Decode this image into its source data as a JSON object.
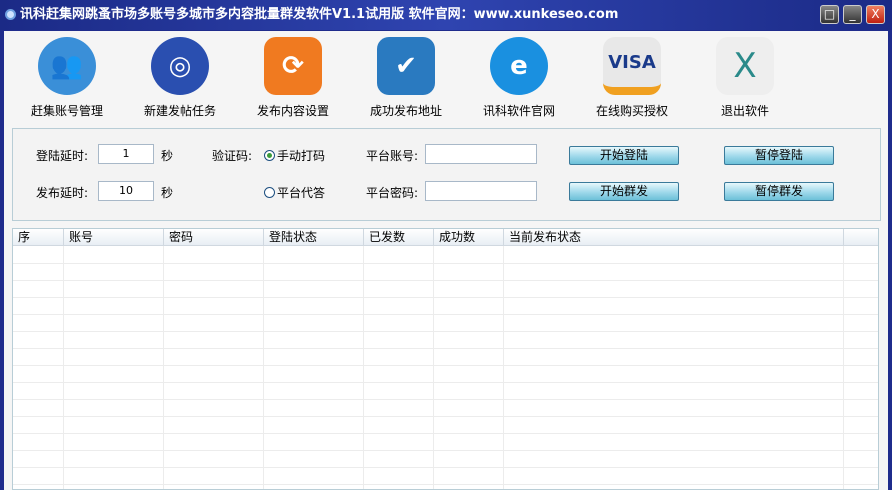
{
  "window": {
    "title": "讯科赶集网跳蚤市场多账号多城市多内容批量群发软件V1.1试用版 软件官网：www.xunkeseo.com",
    "max": "□",
    "min": "_",
    "close": "X"
  },
  "toolbar": [
    {
      "label": "赶集账号管理",
      "icon": "users-icon",
      "glyph": "👥",
      "color": "#3a8fd8"
    },
    {
      "label": "新建发帖任务",
      "icon": "globe-refresh-icon",
      "glyph": "◎",
      "color": "#2a4fb0"
    },
    {
      "label": "发布内容设置",
      "icon": "sync-icon",
      "glyph": "⟳",
      "color": "#f07a20"
    },
    {
      "label": "成功发布地址",
      "icon": "browser-check-icon",
      "glyph": "✔",
      "color": "#2a7ac0"
    },
    {
      "label": "讯科软件官网",
      "icon": "ie-browser-icon",
      "glyph": "e",
      "color": "#1a90e0"
    },
    {
      "label": "在线购买授权",
      "icon": "visa-card-icon",
      "glyph": "VISA",
      "color": "#e8e8e8"
    },
    {
      "label": "退出软件",
      "icon": "exit-x-icon",
      "glyph": "X",
      "color": "#eeeeee"
    }
  ],
  "settings": {
    "login_delay_label": "登陆延时:",
    "login_delay": "1",
    "sec": "秒",
    "post_delay_label": "发布延时:",
    "post_delay": "10",
    "captcha_label": "验证码:",
    "captcha_manual": "手动打码",
    "captcha_platform": "平台代答",
    "account_label": "平台账号:",
    "account": "",
    "password_label": "平台密码:",
    "password": "",
    "start_login": "开始登陆",
    "pause_login": "暂停登陆",
    "start_post": "开始群发",
    "pause_post": "暂停群发"
  },
  "table": {
    "columns": [
      "序",
      "账号",
      "密码",
      "登陆状态",
      "已发数",
      "成功数",
      "当前发布状态",
      ""
    ],
    "rows": []
  }
}
